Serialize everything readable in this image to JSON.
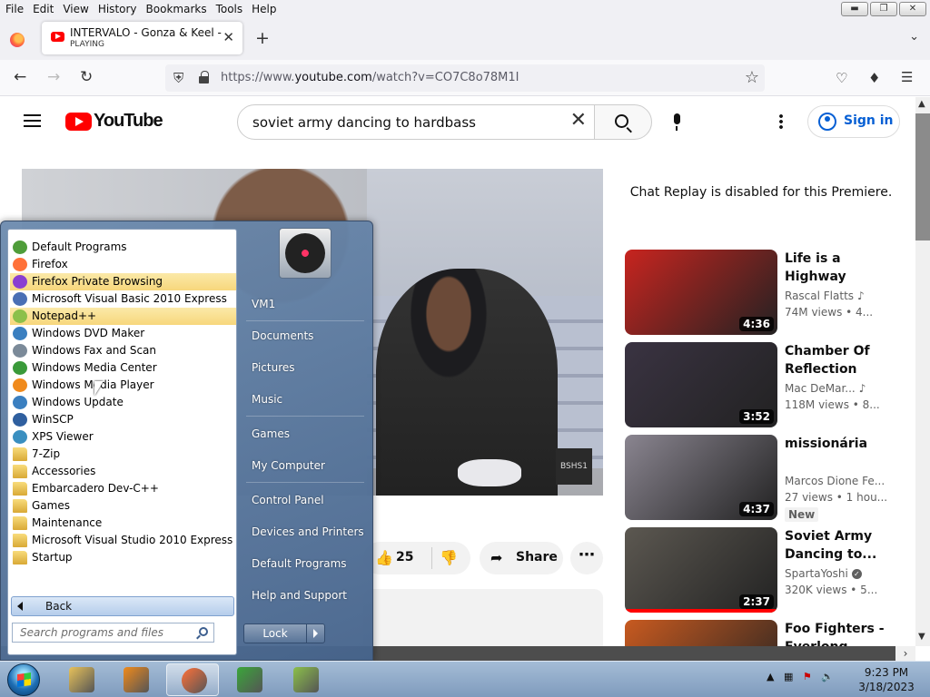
{
  "menubar": {
    "items": [
      "File",
      "Edit",
      "View",
      "History",
      "Bookmarks",
      "Tools",
      "Help"
    ]
  },
  "window_controls": [
    "minimize",
    "restore",
    "close"
  ],
  "browser": {
    "tab": {
      "title": "INTERVALO - Gonza & Keel - YouTube",
      "status": "PLAYING"
    },
    "url": {
      "prefix": "https://www.",
      "domain": "youtube.com",
      "path": "/watch?v=CO7C8o78M1I"
    }
  },
  "youtube": {
    "logo_text": "YouTube",
    "search_query": "soviet army dancing to hardbass",
    "sign_in": "Sign in",
    "watermark": "BSHS1",
    "actions": {
      "like_count": "25",
      "share": "Share"
    },
    "chat_replay": "Chat Replay is disabled for this Premiere.",
    "recommendations": [
      {
        "title": "Life is a Highway",
        "channel": "Rascal Flatts",
        "meta": "74M views • 4...",
        "duration": "4:36",
        "badge": "",
        "icon": "music-note-icon",
        "thumb_color": "#c8241f"
      },
      {
        "title": "Chamber Of Reflection",
        "channel": "Mac DeMar...",
        "meta": "118M views • 8...",
        "duration": "3:52",
        "badge": "",
        "icon": "music-note-icon",
        "thumb_color": "#3a3342"
      },
      {
        "title": "missionária",
        "channel": "Marcos Dione Fe...",
        "meta": "27 views • 1 hou...",
        "duration": "4:37",
        "badge": "New",
        "icon": "",
        "thumb_color": "#8a8590"
      },
      {
        "title": "Soviet Army Dancing to...",
        "channel": "SpartaYoshi",
        "meta": "320K views • 5...",
        "duration": "2:37",
        "badge": "",
        "icon": "verified-icon",
        "thumb_color": "#5c5851",
        "watched": 1.0
      },
      {
        "title": "Foo Fighters - Everlong",
        "channel": "",
        "meta": "",
        "duration": "",
        "badge": "",
        "icon": "",
        "thumb_color": "#c85a20"
      }
    ]
  },
  "start_menu": {
    "programs": [
      {
        "label": "Default Programs",
        "icon": "default-programs-icon",
        "color": "#4f9d3a",
        "highlight": false
      },
      {
        "label": "Firefox",
        "icon": "firefox-icon",
        "color": "#ff7139",
        "highlight": false
      },
      {
        "label": "Firefox Private Browsing",
        "icon": "firefox-private-icon",
        "color": "#8a3fd1",
        "highlight": true
      },
      {
        "label": "Microsoft Visual Basic 2010 Express",
        "icon": "visual-basic-icon",
        "color": "#4a6fb5",
        "highlight": false
      },
      {
        "label": "Notepad++",
        "icon": "notepadpp-icon",
        "color": "#8cc04a",
        "highlight": true
      },
      {
        "label": "Windows DVD Maker",
        "icon": "dvd-maker-icon",
        "color": "#3a7fc0",
        "highlight": false
      },
      {
        "label": "Windows Fax and Scan",
        "icon": "fax-scan-icon",
        "color": "#7b8a99",
        "highlight": false
      },
      {
        "label": "Windows Media Center",
        "icon": "media-center-icon",
        "color": "#3a9a3a",
        "highlight": false
      },
      {
        "label": "Windows Media Player",
        "icon": "media-player-icon",
        "color": "#f08a1c",
        "highlight": false
      },
      {
        "label": "Windows Update",
        "icon": "windows-update-icon",
        "color": "#3a7fc0",
        "highlight": false
      },
      {
        "label": "WinSCP",
        "icon": "winscp-icon",
        "color": "#2f5f9f",
        "highlight": false
      },
      {
        "label": "XPS Viewer",
        "icon": "xps-viewer-icon",
        "color": "#3a8fc0",
        "highlight": false
      },
      {
        "label": "7-Zip",
        "icon": "folder-icon",
        "color": "folder",
        "highlight": false
      },
      {
        "label": "Accessories",
        "icon": "folder-icon",
        "color": "folder",
        "highlight": false
      },
      {
        "label": "Embarcadero Dev-C++",
        "icon": "folder-icon",
        "color": "folder",
        "highlight": false
      },
      {
        "label": "Games",
        "icon": "folder-icon",
        "color": "folder",
        "highlight": false
      },
      {
        "label": "Maintenance",
        "icon": "folder-icon",
        "color": "folder",
        "highlight": false
      },
      {
        "label": "Microsoft Visual Studio 2010 Express",
        "icon": "folder-icon",
        "color": "folder",
        "highlight": false
      },
      {
        "label": "Startup",
        "icon": "folder-icon",
        "color": "folder",
        "highlight": false
      }
    ],
    "back": "Back",
    "search_placeholder": "Search programs and files",
    "right": [
      "VM1",
      "Documents",
      "Pictures",
      "Music",
      "Games",
      "My Computer",
      "Control Panel",
      "Devices and Printers",
      "Default Programs",
      "Help and Support"
    ],
    "lock": "Lock"
  },
  "taskbar": {
    "apps": [
      {
        "name": "explorer",
        "icon": "explorer-icon",
        "color": "#e8c25a",
        "active": false
      },
      {
        "name": "media-player",
        "icon": "media-player-icon",
        "color": "#f08a1c",
        "active": false
      },
      {
        "name": "firefox",
        "icon": "firefox-icon",
        "color": "#ff7139",
        "active": true
      },
      {
        "name": "csharp",
        "icon": "csharp-icon",
        "color": "#3aa63a",
        "active": false
      },
      {
        "name": "notepadpp",
        "icon": "notepadpp-icon",
        "color": "#8cc04a",
        "active": false
      }
    ],
    "time": "9:23 PM",
    "date": "3/18/2023"
  }
}
